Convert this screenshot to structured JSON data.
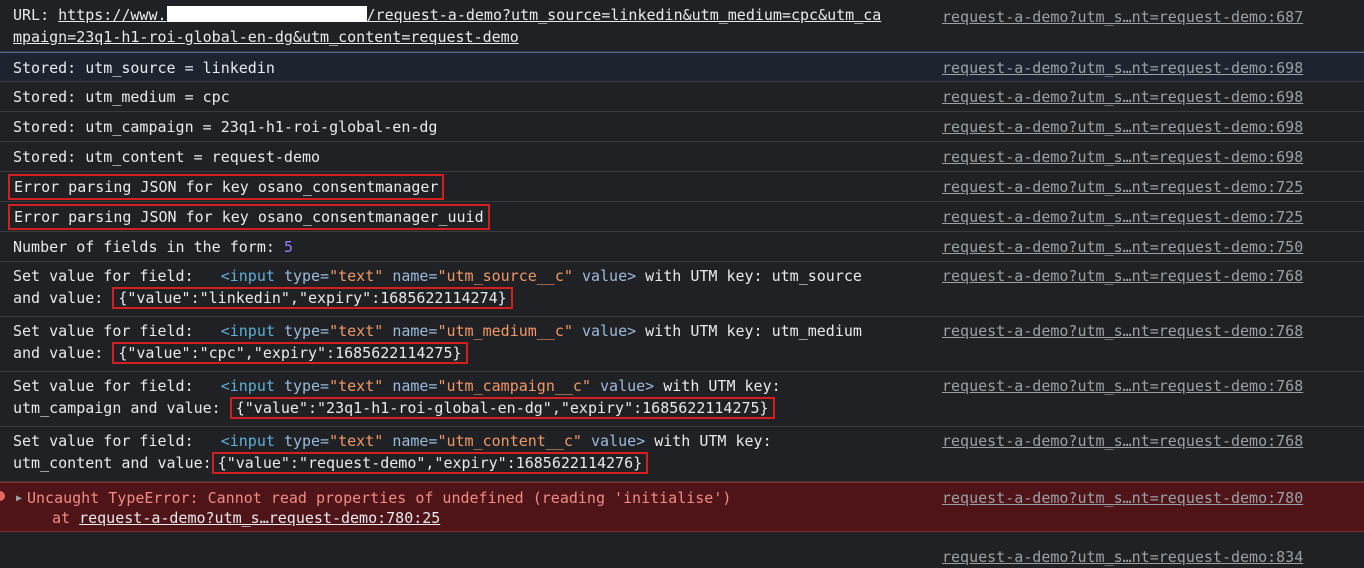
{
  "rows": [
    {
      "url_label": "URL:",
      "url_prefix": "https://www.",
      "url_suffix_line1": "/request-a-demo?utm_source=linkedin&utm_medium=cpc&utm_ca",
      "url_line2": "mpaign=23q1-h1-roi-global-en-dg&utm_content=request-demo",
      "source": "request-a-demo?utm_s…nt=request-demo:687"
    },
    {
      "text": "Stored: utm_source = linkedin",
      "source": "request-a-demo?utm_s…nt=request-demo:698"
    },
    {
      "text": "Stored: utm_medium = cpc",
      "source": "request-a-demo?utm_s…nt=request-demo:698"
    },
    {
      "text": "Stored: utm_campaign = 23q1-h1-roi-global-en-dg",
      "source": "request-a-demo?utm_s…nt=request-demo:698"
    },
    {
      "text": "Stored: utm_content = request-demo",
      "source": "request-a-demo?utm_s…nt=request-demo:698"
    },
    {
      "text": "Error parsing JSON for key osano_consentmanager",
      "source": "request-a-demo?utm_s…nt=request-demo:725"
    },
    {
      "text": "Error parsing JSON for key osano_consentmanager_uuid",
      "source": "request-a-demo?utm_s…nt=request-demo:725"
    },
    {
      "text": "Number of fields in the form: ",
      "count": "5",
      "source": "request-a-demo?utm_s…nt=request-demo:750"
    }
  ],
  "field_rows": [
    {
      "prefix": "Set value for field:",
      "tag_open": "<input",
      "type_attr": "type=",
      "type_val": "\"text\"",
      "name_attr": "name=",
      "name_val": "\"utm_source__c\"",
      "value_attr": "value>",
      "key_text_l1": " with UTM key: utm_source",
      "line2_prefix": "and value: ",
      "json": "{\"value\":\"linkedin\",\"expiry\":1685622114274}",
      "source": "request-a-demo?utm_s…nt=request-demo:768"
    },
    {
      "prefix": "Set value for field:",
      "tag_open": "<input",
      "type_attr": "type=",
      "type_val": "\"text\"",
      "name_attr": "name=",
      "name_val": "\"utm_medium__c\"",
      "value_attr": "value>",
      "key_text_l1": " with UTM key: utm_medium",
      "line2_prefix": "and value: ",
      "json": "{\"value\":\"cpc\",\"expiry\":1685622114275}",
      "source": "request-a-demo?utm_s…nt=request-demo:768"
    },
    {
      "prefix": "Set value for field:",
      "tag_open": "<input",
      "type_attr": "type=",
      "type_val": "\"text\"",
      "name_attr": "name=",
      "name_val": "\"utm_campaign__c\"",
      "value_attr": "value>",
      "key_text_l1": " with UTM key:",
      "line2_prefix": "utm_campaign and value: ",
      "json": "{\"value\":\"23q1-h1-roi-global-en-dg\",\"expiry\":1685622114275}",
      "source": "request-a-demo?utm_s…nt=request-demo:768"
    },
    {
      "prefix": "Set value for field:",
      "tag_open": "<input",
      "type_attr": "type=",
      "type_val": "\"text\"",
      "name_attr": "name=",
      "name_val": "\"utm_content__c\"",
      "value_attr": "value>",
      "key_text_l1": " with UTM key:",
      "line2_prefix": "utm_content and value:",
      "json": "{\"value\":\"request-demo\",\"expiry\":1685622114276}",
      "source": "request-a-demo?utm_s…nt=request-demo:768"
    }
  ],
  "error": {
    "message": "Uncaught TypeError: Cannot read properties of undefined (reading 'initialise')",
    "at_label": "at ",
    "at_link": "request-a-demo?utm_s…request-demo:780:25",
    "source": "request-a-demo?utm_s…nt=request-demo:780"
  },
  "last_row": {
    "source": "request-a-demo?utm_s…nt=request-demo:834"
  },
  "colors": {
    "highlight_border": "#d31f1f",
    "error_bg": "#4e1418",
    "error_text": "#f28b82"
  }
}
